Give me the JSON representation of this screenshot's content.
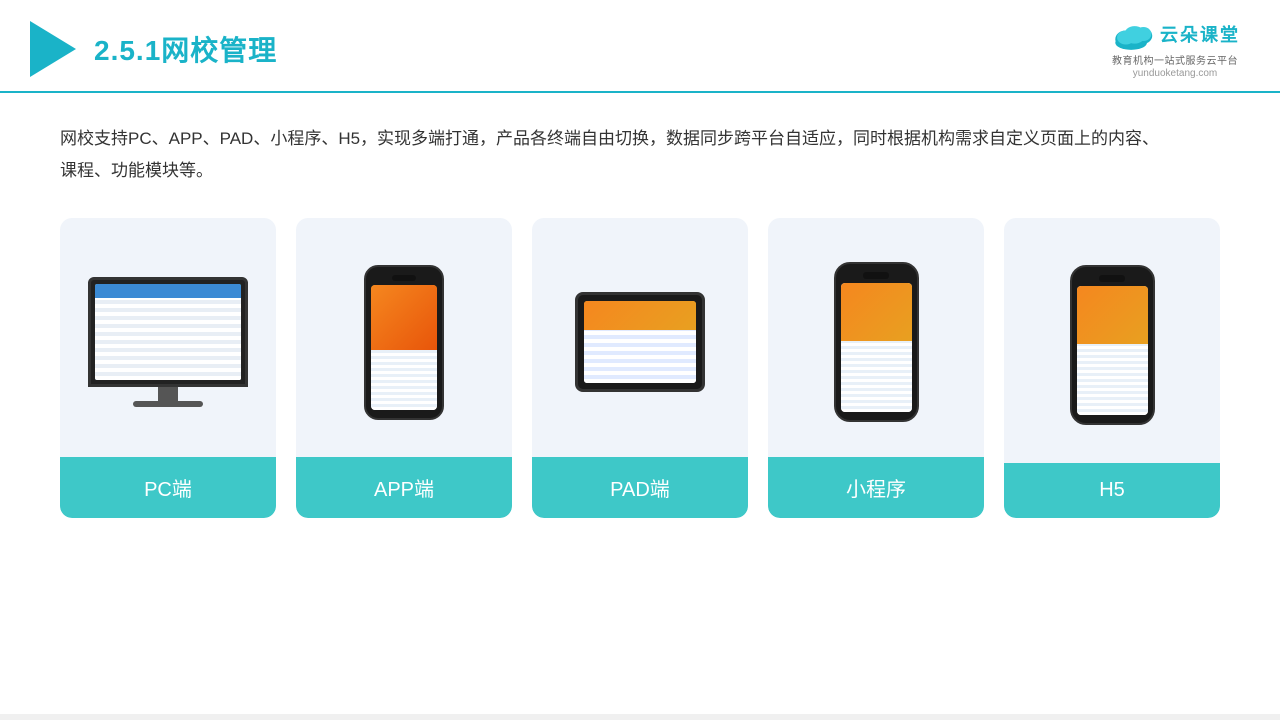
{
  "header": {
    "title_prefix": "2.5.1",
    "title_cn": "网校管理",
    "brand": {
      "name_cn": "云朵课堂",
      "name_pinyin": "yunduoketang.com",
      "tagline_line1": "教育机构一站",
      "tagline_line2": "式服务云平台"
    }
  },
  "description": "网校支持PC、APP、PAD、小程序、H5，实现多端打通，产品各终端自由切换，数据同步跨平台自适应，同时根据机构需求自定义页面上的内容、课程、功能模块等。",
  "cards": [
    {
      "id": "pc",
      "label": "PC端"
    },
    {
      "id": "app",
      "label": "APP端"
    },
    {
      "id": "pad",
      "label": "PAD端"
    },
    {
      "id": "mini",
      "label": "小程序"
    },
    {
      "id": "h5",
      "label": "H5"
    }
  ],
  "colors": {
    "accent": "#1ab3c8",
    "card_bg": "#f0f4fa",
    "label_bg": "#3ec8c8",
    "label_text": "#ffffff"
  }
}
